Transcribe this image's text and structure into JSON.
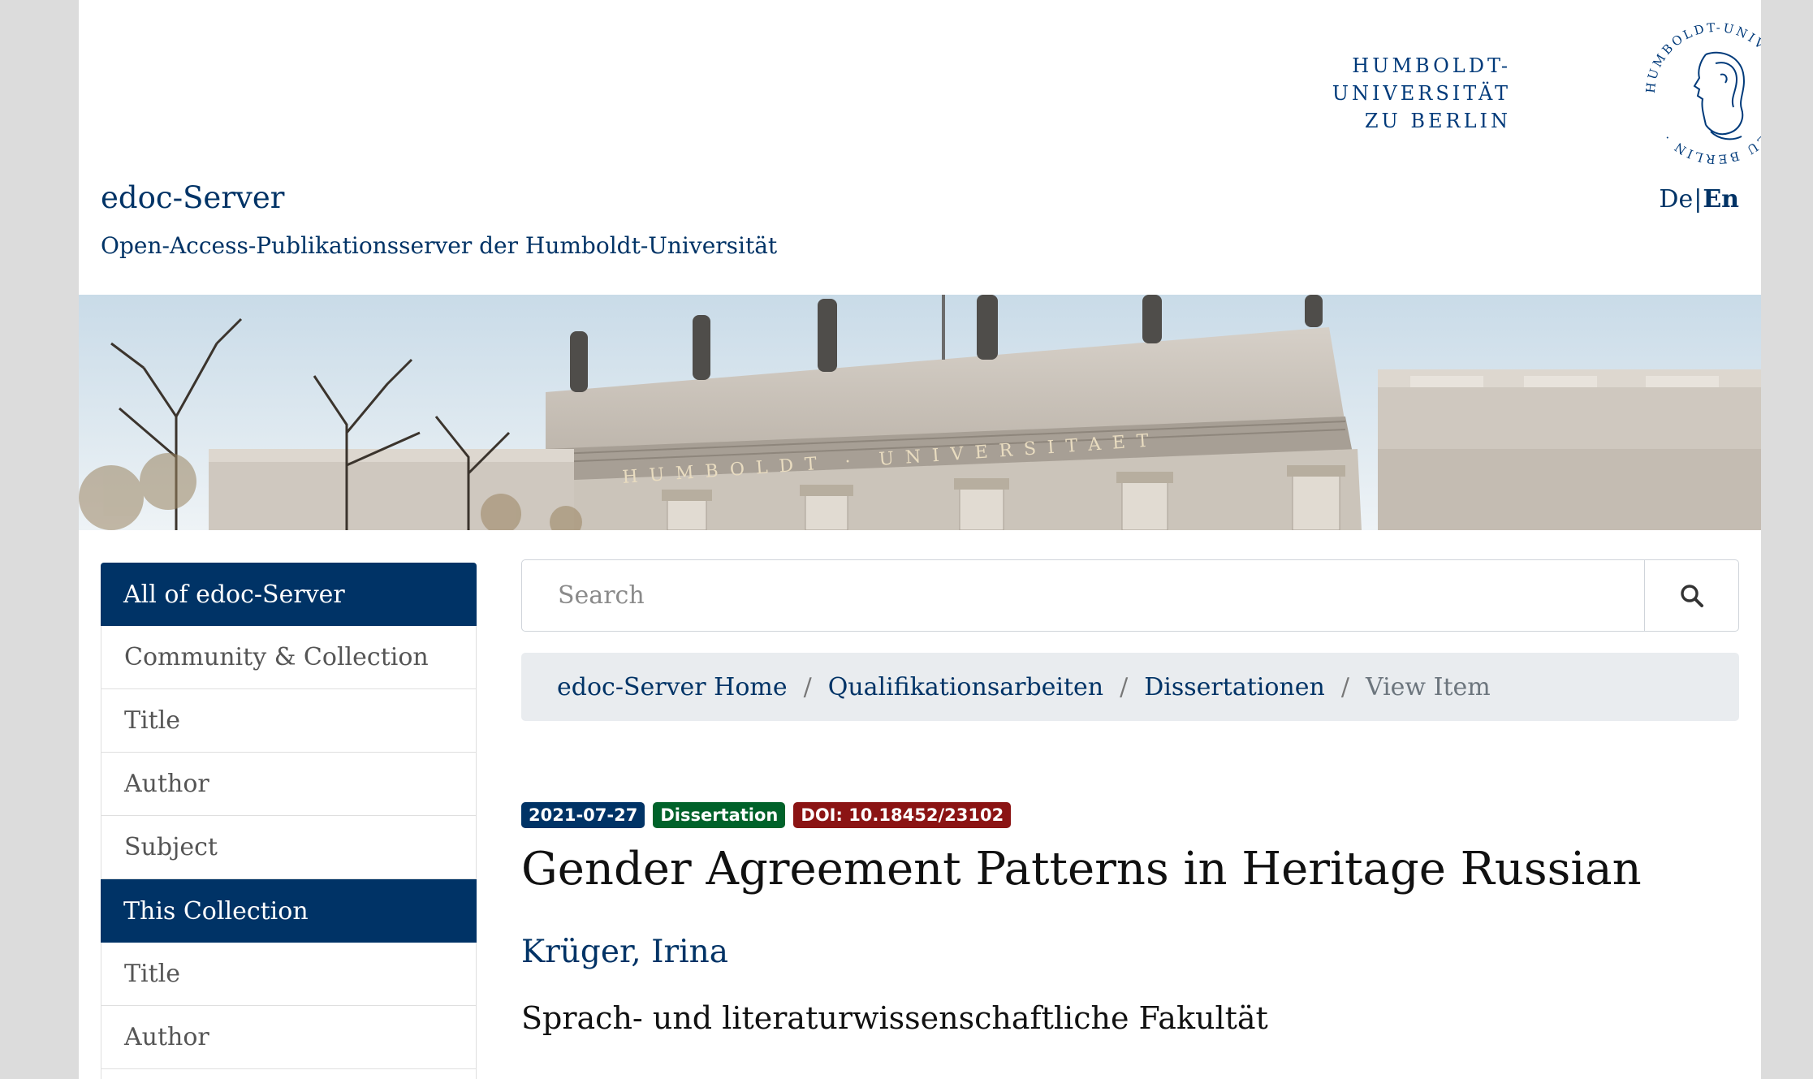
{
  "header": {
    "site_title": "edoc-Server",
    "site_subtitle": "Open-Access-Publikationsserver der Humboldt-Universität",
    "logo_lines": [
      "HUMBOLDT-",
      "UNIVERSITÄT",
      "ZU BERLIN"
    ],
    "seal_text": "HUMBOLDT-UNIVERSITÄT · ZU BERLIN ·",
    "lang_de": "De",
    "lang_sep": "|",
    "lang_en": "En",
    "banner_inscription": "HUMBOLDT · UNIVERSITAET"
  },
  "sidebar": {
    "all_heading": "All of edoc-Server",
    "all_items": [
      {
        "label": "Community & Collection"
      },
      {
        "label": "Title"
      },
      {
        "label": "Author"
      },
      {
        "label": "Subject"
      }
    ],
    "collection_heading": "This Collection",
    "collection_items": [
      {
        "label": "Title"
      },
      {
        "label": "Author"
      },
      {
        "label": ""
      }
    ]
  },
  "search": {
    "placeholder": "Search",
    "icon": "search-icon"
  },
  "breadcrumb": {
    "items": [
      "edoc-Server Home",
      "Qualifikationsarbeiten",
      "Dissertationen"
    ],
    "separator": "/",
    "current": "View Item"
  },
  "item": {
    "date_badge": "2021-07-27",
    "type_badge": "Dissertation",
    "doi_badge": "DOI: 10.18452/23102",
    "title": "Gender Agreement Patterns in Heritage Russian",
    "author": "Krüger, Irina",
    "faculty": "Sprach- und literaturwissenschaftliche Fakultät"
  },
  "colors": {
    "brand": "#003366",
    "badge_date": "#003366",
    "badge_type": "#00622a",
    "badge_doi": "#8b1414"
  }
}
